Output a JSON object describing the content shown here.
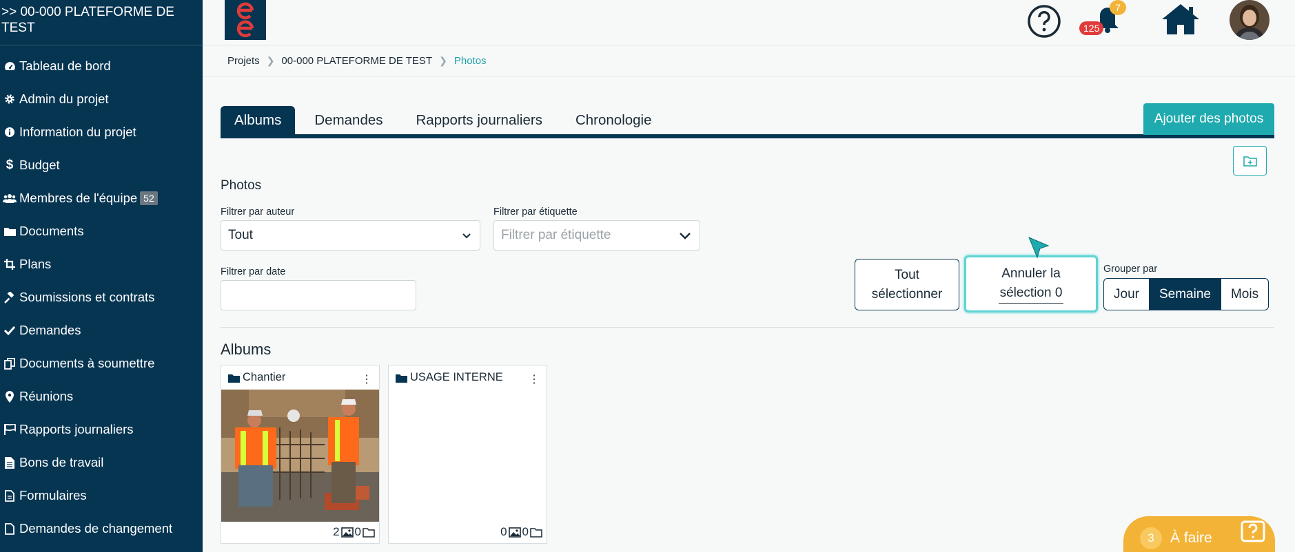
{
  "sidebar": {
    "project_title": ">> 00-000 PLATEFORME DE TEST",
    "items": [
      {
        "label": "Tableau de bord",
        "icon": "dashboard-icon"
      },
      {
        "label": "Admin du projet",
        "icon": "gear-icon"
      },
      {
        "label": "Information du projet",
        "icon": "info-icon"
      },
      {
        "label": "Budget",
        "icon": "dollar-icon"
      },
      {
        "label": "Membres de l'équipe",
        "icon": "users-icon",
        "badge": "52"
      },
      {
        "label": "Documents",
        "icon": "folder-icon"
      },
      {
        "label": "Plans",
        "icon": "crop-icon"
      },
      {
        "label": "Soumissions et contrats",
        "icon": "gavel-icon"
      },
      {
        "label": "Demandes",
        "icon": "check-icon"
      },
      {
        "label": "Documents à soumettre",
        "icon": "copy-icon"
      },
      {
        "label": "Réunions",
        "icon": "map-marker-icon"
      },
      {
        "label": "Rapports journaliers",
        "icon": "flag-icon"
      },
      {
        "label": "Bons de travail",
        "icon": "file-text-icon"
      },
      {
        "label": "Formulaires",
        "icon": "file-icon"
      },
      {
        "label": "Demandes de changement",
        "icon": "file-outline-icon"
      }
    ]
  },
  "topbar": {
    "notifications_badge": "7",
    "notifications_count": "125",
    "icons": [
      "help-icon",
      "bell-icon",
      "home-icon",
      "avatar"
    ]
  },
  "breadcrumb": {
    "items": [
      "Projets",
      "00-000 PLATEFORME DE TEST",
      "Photos"
    ]
  },
  "tabs": [
    "Albums",
    "Demandes",
    "Rapports journaliers",
    "Chronologie"
  ],
  "add_photos_label": "Ajouter des photos",
  "photos_section": {
    "title": "Photos",
    "filter_author_label": "Filtrer par auteur",
    "filter_author_value": "Tout",
    "filter_tag_label": "Filtrer par étiquette",
    "filter_tag_placeholder": "Filtrer par étiquette",
    "filter_date_label": "Filtrer par date",
    "select_all_line1": "Tout",
    "select_all_line2": "sélectionner",
    "cancel_line1": "Annuler la",
    "cancel_line2": "sélection 0",
    "group_by_label": "Grouper par",
    "group_by_options": [
      "Jour",
      "Semaine",
      "Mois"
    ],
    "group_by_selected": "Semaine"
  },
  "albums": {
    "title": "Albums",
    "items": [
      {
        "name": "Chantier",
        "photos": "2",
        "folders": "0"
      },
      {
        "name": "USAGE INTERNE",
        "photos": "0",
        "folders": "0"
      }
    ]
  },
  "todo": {
    "count": "3",
    "label": "À faire"
  },
  "colors": {
    "navy": "#063552",
    "teal": "#1eaaaf",
    "orange": "#f3b336",
    "red": "#e03b3b"
  }
}
